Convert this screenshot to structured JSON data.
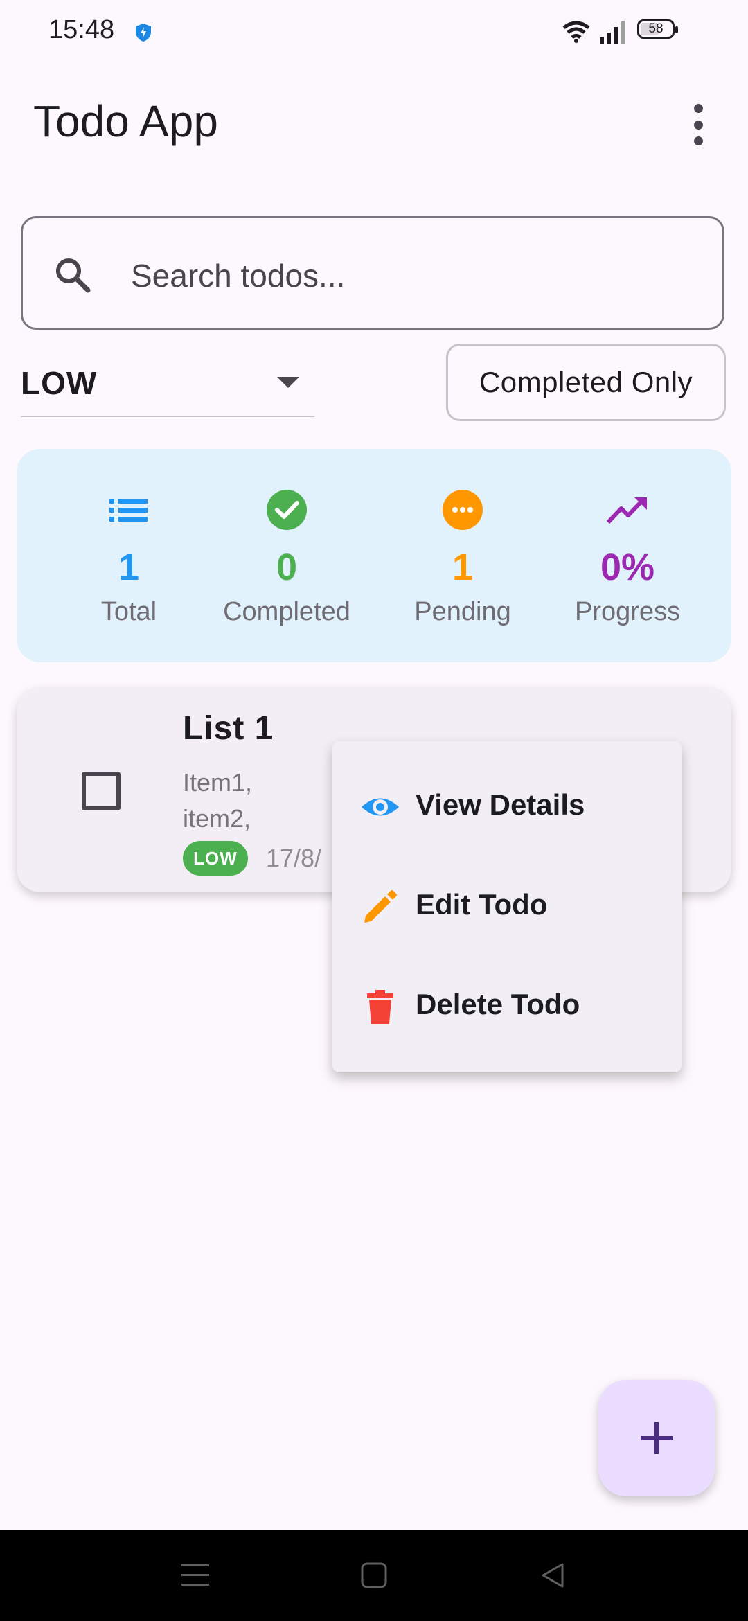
{
  "status_bar": {
    "time": "15:48",
    "battery": "58",
    "icons": [
      "shield-bolt-icon",
      "wifi-icon",
      "signal-icon",
      "battery-icon"
    ]
  },
  "app_bar": {
    "title": "Todo App",
    "overflow_icon": "more-vert-icon"
  },
  "search": {
    "placeholder": "Search todos...",
    "value": ""
  },
  "filters": {
    "priority_selected": "LOW",
    "completed_toggle_label": "Completed Only"
  },
  "stats": [
    {
      "icon": "list-icon",
      "value": "1",
      "label": "Total",
      "color": "#2196f3"
    },
    {
      "icon": "check-circle-icon",
      "value": "0",
      "label": "Completed",
      "color": "#4caf50"
    },
    {
      "icon": "pending-icon",
      "value": "1",
      "label": "Pending",
      "color": "#ff9800"
    },
    {
      "icon": "trending-up-icon",
      "value": "0%",
      "label": "Progress",
      "color": "#9c27b0"
    }
  ],
  "todos": [
    {
      "title": "List 1",
      "description_lines": [
        "Item1,",
        "item2,"
      ],
      "priority": "LOW",
      "date": "17/8/",
      "completed": false
    }
  ],
  "context_menu": {
    "items": [
      {
        "icon": "eye-icon",
        "label": "View Details",
        "color": "#2196f3"
      },
      {
        "icon": "pencil-icon",
        "label": "Edit Todo",
        "color": "#ff9800"
      },
      {
        "icon": "trash-icon",
        "label": "Delete Todo",
        "color": "#f44336"
      }
    ]
  },
  "fab": {
    "icon": "add-icon"
  },
  "nav_bar": {
    "icons": [
      "menu-icon",
      "home-square-icon",
      "back-triangle-icon"
    ]
  },
  "colors": {
    "background": "#fdf8fd",
    "stats_card": "#e2f2fc",
    "todo_card": "#f3eef5",
    "fab": "#eaddff",
    "badge_low": "#4caf50"
  }
}
